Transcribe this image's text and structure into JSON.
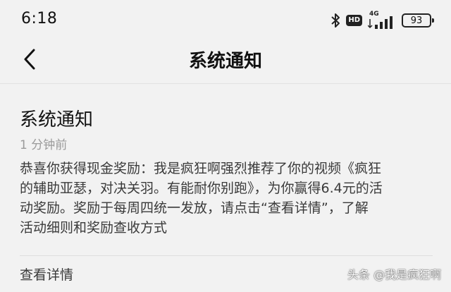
{
  "status_bar": {
    "time": "6:18",
    "hd_label": "HD",
    "network_label": "4G",
    "battery_level": "93",
    "icons": [
      "bluetooth-icon",
      "hd-icon",
      "signal-icon",
      "battery-icon"
    ]
  },
  "nav": {
    "title": "系统通知",
    "back_icon": "chevron-left-icon"
  },
  "message": {
    "title": "系统通知",
    "time": "1 分钟前",
    "body_lines": [
      "恭喜你获得现金奖励：我是疯狂啊强烈推荐了你的视频《疯狂",
      "的辅助亚瑟，对决关羽。有能耐你别跑》，为你赢得6.4元的活",
      "动奖励。奖励于每周四统一发放，请点击“查看详情”，了解",
      "活动细则和奖励查收方式"
    ],
    "detail_link": "查看详情"
  },
  "watermark": "头条 @我是疯狂啊",
  "colors": {
    "background": "#f2f2f2",
    "title": "#111111",
    "body": "#3a3a3a",
    "time": "#9a9a9a"
  }
}
